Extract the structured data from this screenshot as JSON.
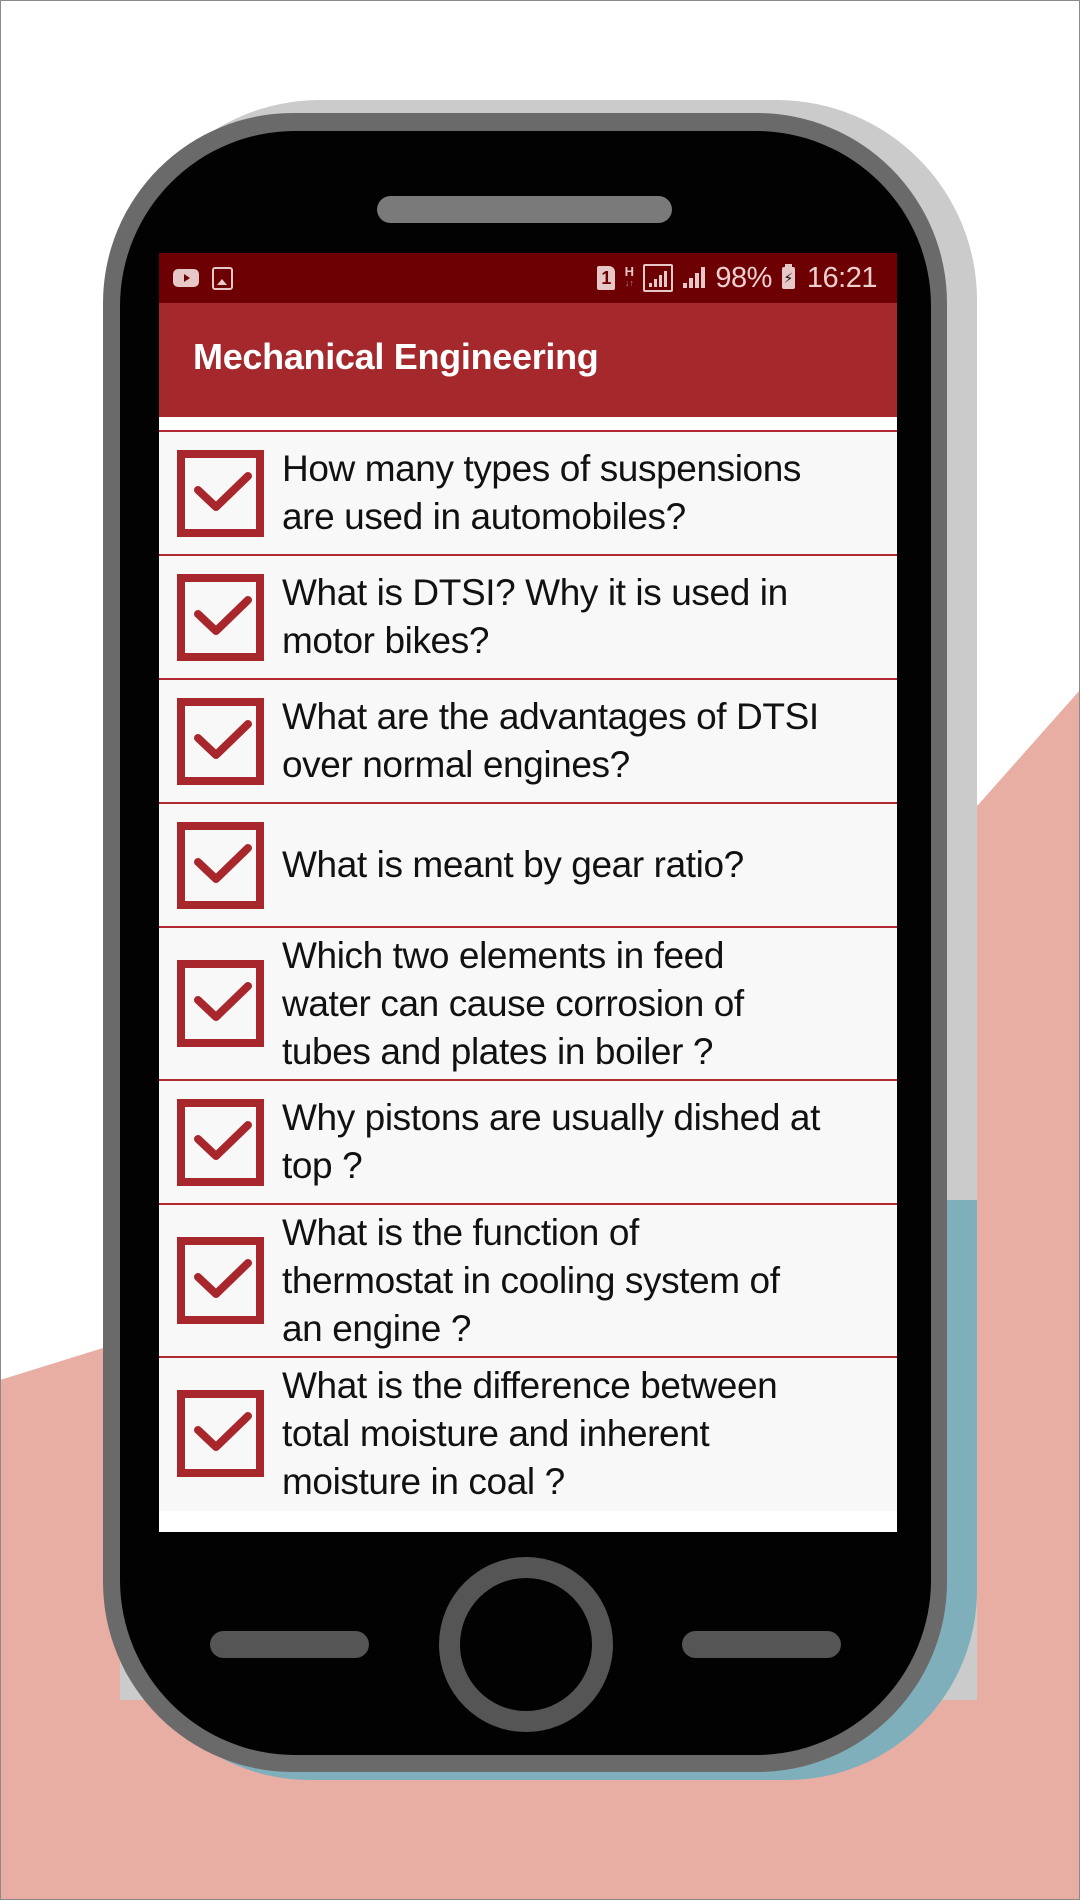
{
  "status_bar": {
    "left_icons": [
      "youtube-icon",
      "gallery-icon"
    ],
    "right_icons": [
      "sim-1-icon",
      "h-data-icon",
      "signal-boxed-icon",
      "signal-icon",
      "battery-charging-icon"
    ],
    "sim_label": "1",
    "data_label": "H",
    "battery_percent": "98%",
    "time": "16:21"
  },
  "app_bar": {
    "title": "Mechanical Engineering"
  },
  "theme": {
    "status_bar_color": "#6d0003",
    "app_bar_color": "#a4282c",
    "accent": "#b22a2f"
  },
  "questions": [
    {
      "checked": true,
      "lines": [
        "How many types of suspensions",
        "are used in automobiles?"
      ]
    },
    {
      "checked": true,
      "lines": [
        "What is DTSI? Why it is used in",
        "motor bikes?"
      ]
    },
    {
      "checked": true,
      "lines": [
        "What are the advantages of DTSI",
        "over normal engines?"
      ]
    },
    {
      "checked": true,
      "lines": [
        "What is meant by gear ratio?"
      ]
    },
    {
      "checked": true,
      "lines": [
        "Which two elements in feed",
        "water can cause corrosion of",
        "tubes and plates in boiler ?"
      ]
    },
    {
      "checked": true,
      "lines": [
        "Why pistons are usually dished at",
        "top ?"
      ]
    },
    {
      "checked": true,
      "lines": [
        "What is the function of",
        "thermostat in cooling system of",
        "an engine ?"
      ]
    },
    {
      "checked": true,
      "lines": [
        "What is the difference between",
        "total moisture and inherent",
        "moisture in coal ?"
      ]
    }
  ]
}
